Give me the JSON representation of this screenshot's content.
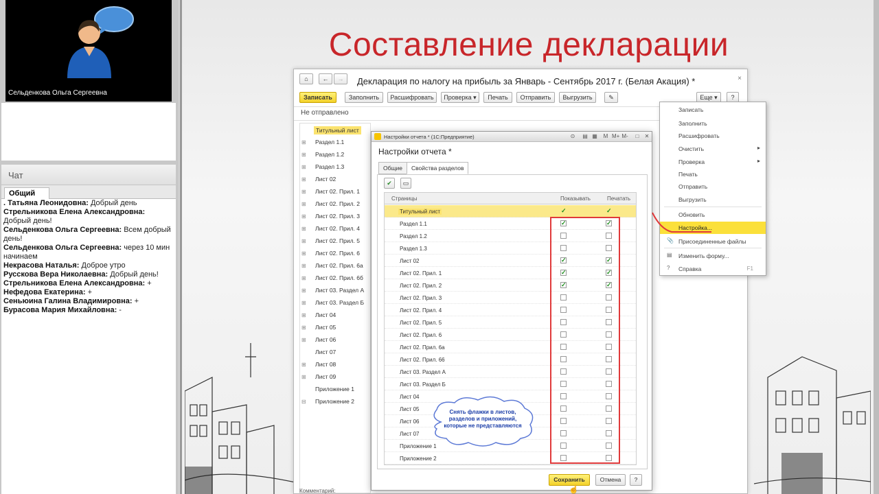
{
  "presenter": {
    "name": "Сельденкова Ольга Сергеевна"
  },
  "chat": {
    "title": "Чат",
    "tab": "Общий",
    "messages": [
      {
        "author": ". Татьяна Леонидовна:",
        "text": " Добрый день"
      },
      {
        "author": "Стрельникова Елена Александровна:",
        "text": " Добрый день!"
      },
      {
        "author": "Сельденкова Ольга Сергеевна:",
        "text": " Всем добрый день!"
      },
      {
        "author": "Сельденкова Ольга Сергеевна:",
        "text": " через 10 мин начинаем"
      },
      {
        "author": "Некрасова Наталья:",
        "text": " Доброе утро"
      },
      {
        "author": "Русскова Вера Николаевна:",
        "text": " Добрый день!"
      },
      {
        "author": "Стрельникова Елена Александровна:",
        "text": " +"
      },
      {
        "author": "Нефедова Екатерина:",
        "text": " +"
      },
      {
        "author": "Сеньюина Галина Владимировна:",
        "text": " +"
      },
      {
        "author": "Бурасова Мария Михайловна:",
        "text": " -"
      }
    ]
  },
  "slide": {
    "title": "Составление декларации"
  },
  "doc": {
    "title": "Декларация по налогу на прибыль за Январь - Сентябрь 2017 г. (Белая Акация) *",
    "status": "Не отправлено",
    "toolbar": {
      "write": "Записать",
      "fill": "Заполнить",
      "decode": "Расшифровать",
      "check": "Проверка",
      "print": "Печать",
      "send": "Отправить",
      "upload": "Выгрузить",
      "more": "Еще",
      "help": "?"
    },
    "tree": [
      "Титульный лист",
      "Раздел 1.1",
      "Раздел 1.2",
      "Раздел 1.3",
      "Лист 02",
      "Лист 02. Прил. 1",
      "Лист 02. Прил. 2",
      "Лист 02. Прил. 3",
      "Лист 02. Прил. 4",
      "Лист 02. Прил. 5",
      "Лист 02. Прил. 6",
      "Лист 02. Прил. 6а",
      "Лист 02. Прил. 6б",
      "Лист 03. Раздел А",
      "Лист 03. Раздел Б",
      "Лист 04",
      "Лист 05",
      "Лист 06",
      "Лист 07",
      "Лист 08",
      "Лист 09",
      "Приложение 1",
      "Приложение 2"
    ],
    "comment_label": "Комментарий:"
  },
  "dialog": {
    "window_title": "Настройки отчета * (1С:Предприятие)",
    "title": "Настройки отчета *",
    "tabs": [
      "Общие",
      "Свойства разделов"
    ],
    "columns": {
      "pages": "Страницы",
      "show": "Показывать",
      "print": "Печатать"
    },
    "rows": [
      {
        "name": "Титульный лист",
        "show": true,
        "print": true
      },
      {
        "name": "Раздел 1.1",
        "show": true,
        "print": true
      },
      {
        "name": "Раздел 1.2",
        "show": false,
        "print": false
      },
      {
        "name": "Раздел 1.3",
        "show": false,
        "print": false
      },
      {
        "name": "Лист 02",
        "show": true,
        "print": true
      },
      {
        "name": "Лист 02. Прил. 1",
        "show": true,
        "print": true
      },
      {
        "name": "Лист 02. Прил. 2",
        "show": true,
        "print": true
      },
      {
        "name": "Лист 02. Прил. 3",
        "show": false,
        "print": false
      },
      {
        "name": "Лист 02. Прил. 4",
        "show": false,
        "print": false
      },
      {
        "name": "Лист 02. Прил. 5",
        "show": false,
        "print": false
      },
      {
        "name": "Лист 02. Прил. 6",
        "show": false,
        "print": false
      },
      {
        "name": "Лист 02. Прил. 6а",
        "show": false,
        "print": false
      },
      {
        "name": "Лист 02. Прил. 66",
        "show": false,
        "print": false
      },
      {
        "name": "Лист 03. Раздел А",
        "show": false,
        "print": false
      },
      {
        "name": "Лист 03. Раздел Б",
        "show": false,
        "print": false
      },
      {
        "name": "Лист 04",
        "show": false,
        "print": false
      },
      {
        "name": "Лист 05",
        "show": false,
        "print": false
      },
      {
        "name": "Лист 06",
        "show": false,
        "print": false
      },
      {
        "name": "Лист 07",
        "show": false,
        "print": false
      },
      {
        "name": "Приложение 1",
        "show": false,
        "print": false
      },
      {
        "name": "Приложение 2",
        "show": false,
        "print": false
      }
    ],
    "callout": "Снять флажки в листов, разделов и приложений, которые не представляются",
    "save": "Сохранить",
    "cancel": "Отмена",
    "help": "?"
  },
  "menu": {
    "items": [
      {
        "label": "Записать"
      },
      {
        "label": "Заполнить"
      },
      {
        "label": "Расшифровать"
      },
      {
        "label": "Очистить",
        "submenu": true
      },
      {
        "label": "Проверка",
        "submenu": true
      },
      {
        "label": "Печать"
      },
      {
        "label": "Отправить"
      },
      {
        "label": "Выгрузить"
      },
      {
        "label": "Обновить"
      },
      {
        "label": "Настройка...",
        "selected": true
      },
      {
        "label": "Присоединенные файлы"
      },
      {
        "label": "Изменить форму..."
      },
      {
        "label": "Справка",
        "key": "F1"
      }
    ]
  },
  "colors": {
    "accent_red": "#c8262a",
    "highlight_yellow": "#fbe03a",
    "check_green": "#1e8d1e"
  }
}
